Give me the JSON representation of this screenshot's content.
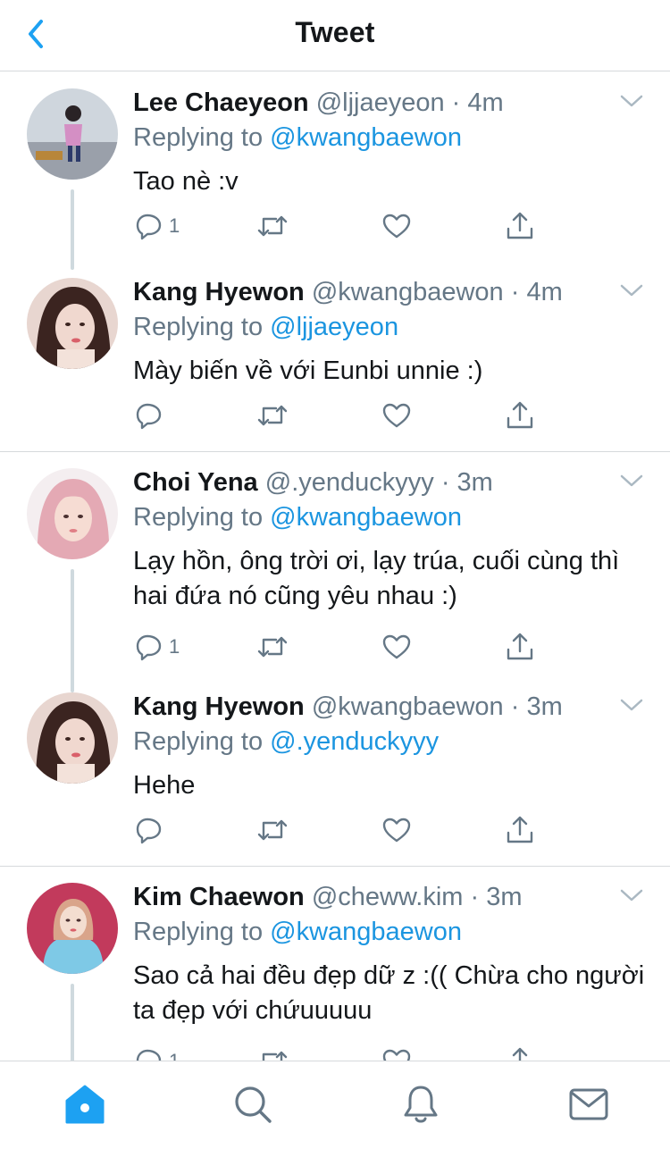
{
  "header": {
    "title": "Tweet"
  },
  "tweets": [
    {
      "name": "Lee Chaeyeon",
      "handle": "@ljjaeyeon",
      "time": "4m",
      "replying_label": "Replying to",
      "replying_to": "@kwangbaewon",
      "text": "Tao nè :v",
      "reply_count": "1",
      "avatar_colors": [
        "#cfd6dd",
        "#8a8f9a",
        "#d48fc4"
      ]
    },
    {
      "name": "Kang Hyewon",
      "handle": "@kwangbaewon",
      "time": "4m",
      "replying_label": "Replying to",
      "replying_to": "@ljjaeyeon",
      "text": "Mày biến về với Eunbi unnie :)",
      "reply_count": "",
      "avatar_colors": [
        "#e8d6d0",
        "#3b2420",
        "#f0d8cf"
      ]
    },
    {
      "name": "Choi Yena",
      "handle": "@.yenduckyyy",
      "time": "3m",
      "replying_label": "Replying to",
      "replying_to": "@kwangbaewon",
      "text": "Lạy hồn, ông trời ơi, lạy trúa, cuối cùng thì hai đứa nó cũng yêu nhau :)",
      "reply_count": "1",
      "avatar_colors": [
        "#f4eef0",
        "#e4a9b4",
        "#f6dcd3"
      ]
    },
    {
      "name": "Kang Hyewon",
      "handle": "@kwangbaewon",
      "time": "3m",
      "replying_label": "Replying to",
      "replying_to": "@.yenduckyyy",
      "text": "Hehe",
      "reply_count": "",
      "avatar_colors": [
        "#e8d6d0",
        "#3b2420",
        "#f0d8cf"
      ]
    },
    {
      "name": "Kim Chaewon",
      "handle": "@cheww.kim",
      "time": "3m",
      "replying_label": "Replying to",
      "replying_to": "@kwangbaewon",
      "text": "Sao cả hai đều đẹp dữ z :(( Chừa cho người ta đẹp với chứuuuuu",
      "reply_count": "1",
      "avatar_colors": [
        "#c23a5c",
        "#7ec9e6",
        "#d9a48a"
      ]
    }
  ],
  "colors": {
    "accent": "#1da1f2",
    "mention": "#1b95e0",
    "muted": "#657786",
    "divider": "#d6d9dc",
    "thread_line": "#cfd9de"
  },
  "icons": {
    "header": "back-chevron-icon",
    "tweet_actions": [
      "reply-icon",
      "retweet-icon",
      "like-icon",
      "share-icon"
    ],
    "tabbar": [
      "home-icon",
      "search-icon",
      "notifications-icon",
      "messages-icon"
    ]
  }
}
